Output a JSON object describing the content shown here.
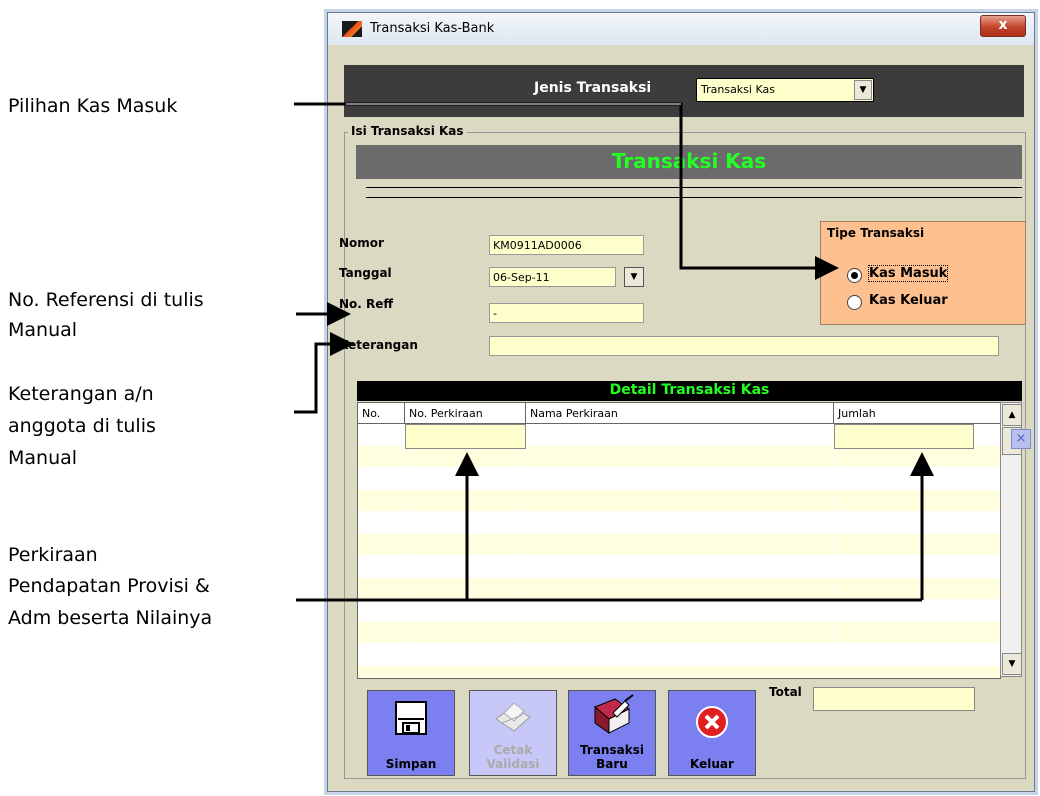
{
  "annotations": {
    "pilihan": "Pilihan Kas Masuk",
    "referensi_1": "No. Referensi di tulis",
    "referensi_2": "Manual",
    "keterangan_1": "Keterangan a/n",
    "keterangan_2": "anggota di tulis",
    "keterangan_3": "Manual",
    "perkiraan_1": "Perkiraan",
    "perkiraan_2": "Pendapatan Provisi &",
    "perkiraan_3": "Adm beserta Nilainya"
  },
  "window": {
    "title": "Transaksi Kas-Bank",
    "close_icon": "close-icon",
    "close_label": "x"
  },
  "jenis": {
    "label": "Jenis Transaksi",
    "value": "Transaksi Kas",
    "arrow": "▼"
  },
  "group": {
    "legend": "Isi Transaksi Kas",
    "header": "Transaksi Kas"
  },
  "form": {
    "nomor_label": "Nomor",
    "nomor_value": "KM0911AD0006",
    "tanggal_label": "Tanggal",
    "tanggal_value": "06-Sep-11",
    "cal_arrow": "▼",
    "reff_label": "No. Reff",
    "reff_value": "-",
    "ket_label": "Keterangan",
    "ket_value": ""
  },
  "tipe": {
    "legend": "Tipe Transaksi",
    "options": [
      {
        "label": "Kas Masuk",
        "selected": true
      },
      {
        "label": "Kas Keluar",
        "selected": false
      }
    ]
  },
  "detail": {
    "title": "Detail Transaksi Kas",
    "columns": [
      "No.",
      "No. Perkiraan",
      "Nama Perkiraan",
      "Jumlah"
    ],
    "rows": 12,
    "scroll_up": "▲",
    "scroll_down": "▼"
  },
  "side_icon": "×",
  "buttons": {
    "simpan": "Simpan",
    "cetak_1": "Cetak",
    "cetak_2": "Validasi",
    "baru_1": "Transaksi",
    "baru_2": "Baru",
    "keluar": "Keluar"
  },
  "total": {
    "label": "Total",
    "value": ""
  },
  "colors": {
    "accent_green": "#22ff22",
    "field_bg": "#ffffcc",
    "tipe_bg": "#ffc090",
    "button_blue": "#7b7ff0"
  }
}
